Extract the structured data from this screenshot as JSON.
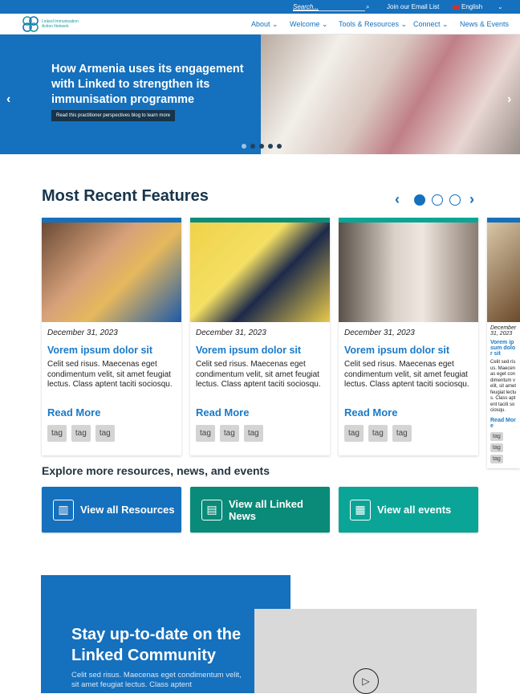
{
  "topbar": {
    "search_placeholder": "Search...",
    "email": "Join our Email List",
    "language": "English"
  },
  "nav": {
    "logo": "Linked Immunisation Action Network",
    "items": [
      "About",
      "Welcome",
      "Tools & Resources",
      "Connect",
      "News & Events"
    ]
  },
  "hero": {
    "title": "How Armenia uses its engagement with Linked to strengthen its immunisation programme",
    "button": "Read this practitioner perspectives blog to learn more",
    "slide_count": 5,
    "active_slide": 1
  },
  "features": {
    "title": "Most Recent Features",
    "active_page": 1,
    "page_count": 3,
    "cards": [
      {
        "date": "December 31, 2023",
        "title": "Vorem ipsum dolor sit",
        "body": "Celit sed risus. Maecenas eget condimentum velit, sit amet feugiat lectus. Class aptent taciti sociosqu.",
        "more": "Read More",
        "tags": [
          "tag",
          "tag",
          "tag"
        ],
        "accent": "#1570bd"
      },
      {
        "date": "December 31, 2023",
        "title": "Vorem ipsum dolor sit",
        "body": "Celit sed risus. Maecenas eget condimentum velit, sit amet feugiat lectus. Class aptent taciti sociosqu.",
        "more": "Read More",
        "tags": [
          "tag",
          "tag",
          "tag"
        ],
        "accent": "#0d8c7b"
      },
      {
        "date": "December 31, 2023",
        "title": "Vorem ipsum dolor sit",
        "body": "Celit sed risus. Maecenas eget condimentum velit, sit amet feugiat lectus. Class aptent taciti sociosqu.",
        "more": "Read More",
        "tags": [
          "tag",
          "tag",
          "tag"
        ],
        "accent": "#0aa595"
      },
      {
        "date": "December 31, 2023",
        "title": "Vorem ipsum dolor sit",
        "body": "Celit sed risus. Maecenas eget condimentum velit, sit amet feugiat lectus. Class aptent taciti sociosqu.",
        "more": "Read More",
        "tags": [
          "tag",
          "tag",
          "tag"
        ],
        "accent": "#1570bd"
      }
    ]
  },
  "explore": {
    "title": "Explore more  resources, news, and events",
    "buttons": [
      {
        "label": "View all Resources",
        "color": "#1570bd",
        "icon": "library-icon"
      },
      {
        "label": "View all Linked News",
        "color": "#0a8a78",
        "icon": "newspaper-icon"
      },
      {
        "label": "View all events",
        "color": "#0ba597",
        "icon": "calendar-icon"
      }
    ]
  },
  "stay": {
    "title": "Stay up-to-date on the Linked Community",
    "body": "Celit sed risus. Maecenas eget condimentum velit, sit amet feugiat lectus. Class aptent"
  }
}
